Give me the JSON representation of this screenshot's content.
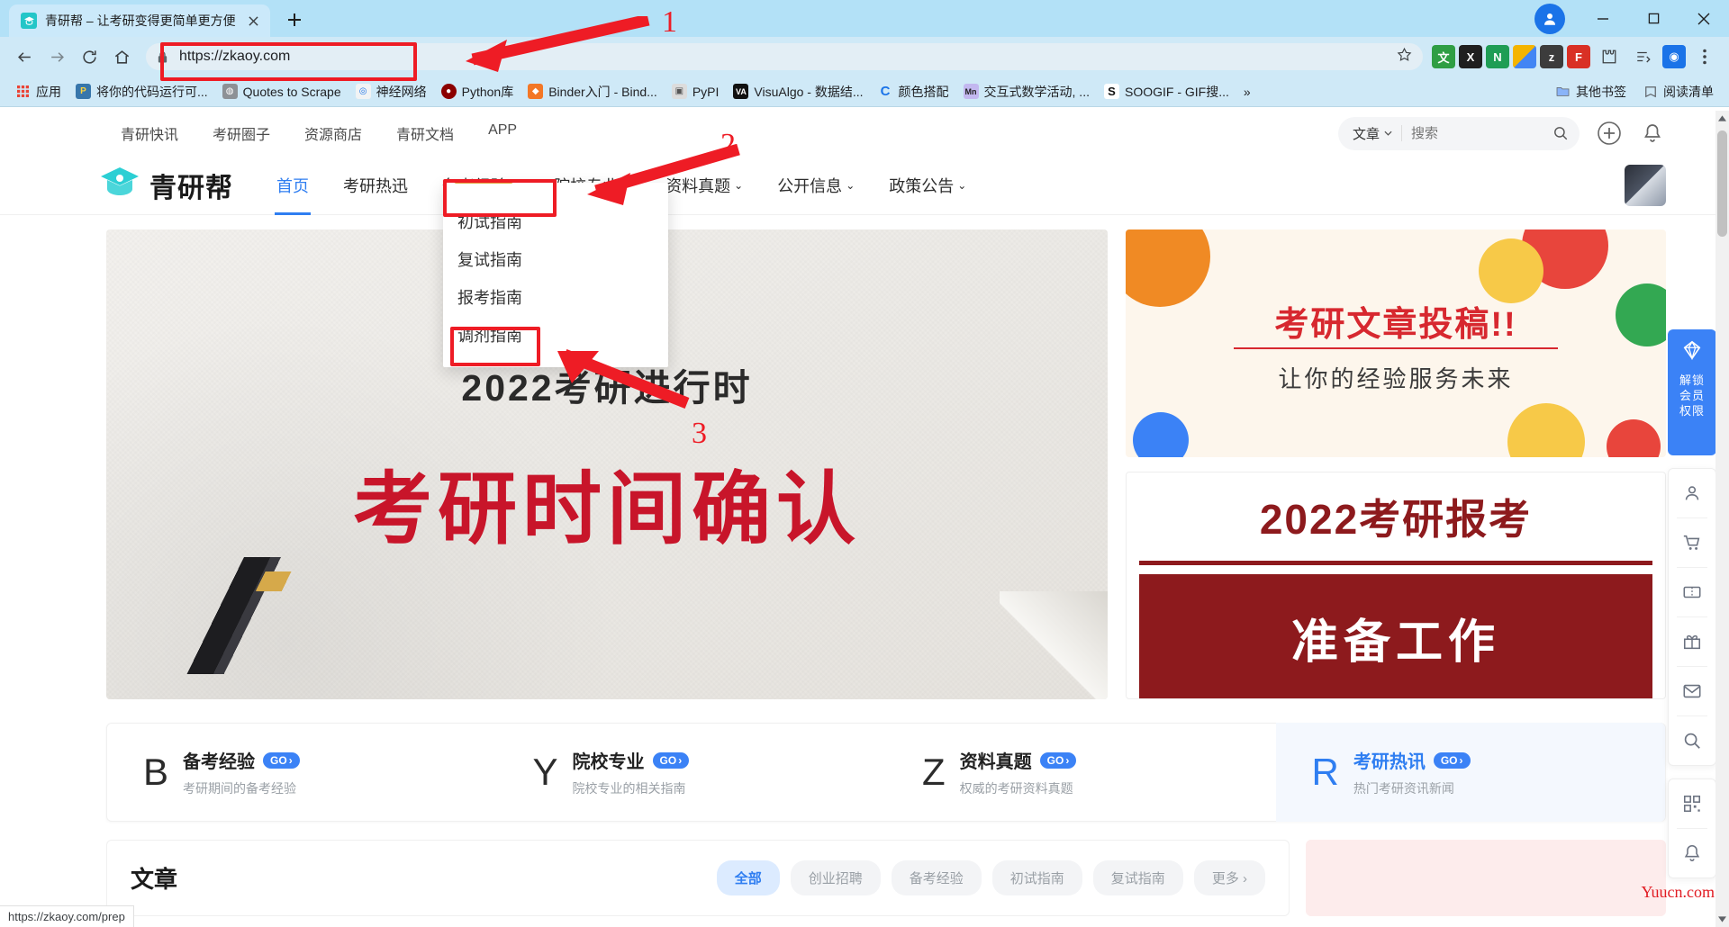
{
  "browser": {
    "tab": {
      "title": "青研帮 – 让考研变得更简单更方便",
      "favicon": "graduation-cap-icon",
      "close": "×"
    },
    "newtab_label": "+",
    "window": {
      "minimize": "−",
      "maximize": "□",
      "close": "✕"
    },
    "omnibox": {
      "url": "https://zkaoy.com",
      "lock_icon": "lock-icon",
      "star_icon": "star-icon"
    },
    "nav": {
      "back": "←",
      "forward": "→",
      "reload": "⟳",
      "home": "⌂"
    },
    "extensions": [
      {
        "name": "translate-extension",
        "glyph": "文",
        "color": "#2f9e44"
      },
      {
        "name": "x-extension",
        "glyph": "X",
        "color": "#1f1f1f"
      },
      {
        "name": "n-extension",
        "glyph": "N",
        "color": "#1f9d55"
      },
      {
        "name": "colors-extension",
        "glyph": "▦",
        "color": "#f4b400"
      },
      {
        "name": "zk-extension",
        "glyph": "z",
        "color": "#3c3c3c"
      },
      {
        "name": "flag-extension",
        "glyph": "F",
        "color": "#d93025"
      },
      {
        "name": "puzzle-extension",
        "glyph": "⚙",
        "color": "#5f6368"
      },
      {
        "name": "list-extension",
        "glyph": "≡",
        "color": "#5f6368"
      },
      {
        "name": "profile-extension",
        "glyph": "◉",
        "color": "#1a73e8"
      }
    ],
    "bookmarks": [
      {
        "label": "应用",
        "icon": "apps-grid-icon",
        "color": "#ea4335"
      },
      {
        "label": "将你的代码运行可...",
        "icon": "python-icon",
        "color": "#3776ab"
      },
      {
        "label": "Quotes to Scrape",
        "icon": "globe-icon",
        "color": "#8d9196"
      },
      {
        "label": "神经网络",
        "icon": "spiral-icon",
        "color": "#1a73e8"
      },
      {
        "label": "Python库",
        "icon": "dark-circle-icon",
        "color": "#8b0000"
      },
      {
        "label": "Binder入门 - Bind...",
        "icon": "binder-icon",
        "color": "#f37726"
      },
      {
        "label": "PyPI",
        "icon": "package-icon",
        "color": "#cccccc"
      },
      {
        "label": "VisuAlgo - 数据结...",
        "icon": "va-icon",
        "color": "#111111"
      },
      {
        "label": "颜色搭配",
        "icon": "c-icon",
        "color": "#1a73e8"
      },
      {
        "label": "交互式数学活动, ...",
        "icon": "math-icon",
        "color": "#c3b8f0"
      },
      {
        "label": "SOOGIF - GIF搜...",
        "icon": "s-icon",
        "color": "#111111"
      }
    ],
    "bookmarks_overflow": "»",
    "bookmarks_right": [
      {
        "label": "其他书签",
        "icon": "folder-icon"
      },
      {
        "label": "阅读清单",
        "icon": "reading-list-icon"
      }
    ],
    "status_text": "https://zkaoy.com/prep"
  },
  "site": {
    "topnav": [
      "青研快讯",
      "考研圈子",
      "资源商店",
      "青研文档",
      "APP"
    ],
    "search": {
      "category": "文章",
      "placeholder": "搜索",
      "icon": "search-icon"
    },
    "header_actions": [
      {
        "name": "add-button",
        "glyph": "+"
      },
      {
        "name": "notifications-button",
        "glyph": "🔔"
      }
    ],
    "logo": {
      "text": "青研帮",
      "icon": "graduation-cap-logo"
    },
    "mainnav": [
      {
        "label": "首页",
        "active": true,
        "caret": ""
      },
      {
        "label": "考研热迅",
        "active": false,
        "caret": ""
      },
      {
        "label": "备考经验",
        "active": false,
        "caret": "⌃",
        "open": true
      },
      {
        "label": "院校专业",
        "active": false,
        "caret": "⌄"
      },
      {
        "label": "资料真题",
        "active": false,
        "caret": "⌄"
      },
      {
        "label": "公开信息",
        "active": false,
        "caret": "⌄"
      },
      {
        "label": "政策公告",
        "active": false,
        "caret": "⌄"
      }
    ],
    "dropdown": {
      "parent": "备考经验",
      "items": [
        {
          "label": "初试指南",
          "highlighted": false
        },
        {
          "label": "复试指南",
          "highlighted": false
        },
        {
          "label": "报考指南",
          "highlighted": true
        },
        {
          "label": "调剂指南",
          "highlighted": false
        }
      ]
    },
    "hero": {
      "subtitle": "2022考研进行时",
      "title": "考研时间确认"
    },
    "promo_top": {
      "line1": "考研文章投稿!!",
      "line2": "让你的经验服务未来"
    },
    "promo_bottom": {
      "line1": "2022考研报考",
      "line2": "准备工作"
    },
    "quick_cards": [
      {
        "letter": "B",
        "title": "备考经验",
        "badge": "GO",
        "desc": "考研期间的备考经验"
      },
      {
        "letter": "Y",
        "title": "院校专业",
        "badge": "GO",
        "desc": "院校专业的相关指南"
      },
      {
        "letter": "Z",
        "title": "资料真题",
        "badge": "GO",
        "desc": "权威的考研资料真题"
      },
      {
        "letter": "R",
        "title": "考研热讯",
        "badge": "GO",
        "desc": "热门考研资讯新闻"
      }
    ],
    "feed": {
      "title": "文章",
      "chips": [
        {
          "label": "全部",
          "active": true
        },
        {
          "label": "创业招聘",
          "active": false
        },
        {
          "label": "备考经验",
          "active": false
        },
        {
          "label": "初试指南",
          "active": false
        },
        {
          "label": "复试指南",
          "active": false
        },
        {
          "label": "更多",
          "active": false,
          "caret": "›"
        }
      ]
    },
    "right_rail": {
      "vip": {
        "icon": "diamond-icon",
        "text": "解锁\n会员\n权限",
        "lines": [
          "解锁",
          "会员",
          "权限"
        ]
      },
      "items": [
        {
          "name": "user-icon",
          "glyph": "person"
        },
        {
          "name": "cart-icon",
          "glyph": "cart"
        },
        {
          "name": "ticket-icon",
          "glyph": "ticket"
        },
        {
          "name": "gift-icon",
          "glyph": "gift"
        },
        {
          "name": "mail-icon",
          "glyph": "mail"
        },
        {
          "name": "search-icon",
          "glyph": "search"
        }
      ],
      "items2": [
        {
          "name": "qrcode-icon",
          "glyph": "qr"
        },
        {
          "name": "bell-icon",
          "glyph": "bell"
        }
      ]
    }
  },
  "annotations": [
    {
      "id": "1",
      "target": "address-bar"
    },
    {
      "id": "2",
      "target": "nav-备考经验"
    },
    {
      "id": "3",
      "target": "dropdown-报考指南"
    }
  ],
  "watermark": "Yuucn.com",
  "colors": {
    "chrome_blue": "#cfe9f7",
    "tab_blue": "#b3e1f7",
    "accent_blue": "#2f7ef1",
    "hero_red": "#c8152a",
    "promo_red": "#d7282f",
    "promo_dark_red": "#8d1a1d",
    "annotation_red": "#ee1c25"
  }
}
